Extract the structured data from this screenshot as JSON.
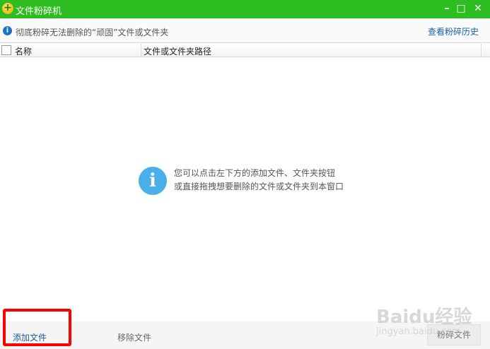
{
  "window": {
    "title": "文件粉碎机",
    "minimize": "–",
    "maximize": "□",
    "close": "✕"
  },
  "infobar": {
    "text": "彻底粉碎无法删除的“顽固”文件或文件夹",
    "history_link": "查看粉碎历史"
  },
  "table": {
    "columns": [
      "名称",
      "文件或文件夹路径"
    ]
  },
  "empty": {
    "line1": "您可以点击左下方的添加文件、文件夹按钮",
    "line2": "或直接拖拽想要删除的文件或文件夹到本窗口"
  },
  "footer": {
    "add": "添加文件",
    "remove": "移除文件",
    "shred": "粉碎文件"
  },
  "watermark": {
    "line1": "Baidu经验",
    "line2": "jingyan.baidu.com"
  },
  "colors": {
    "accent": "#2dbd20",
    "link": "#1a5fa8",
    "highlight": "#ff0000"
  }
}
